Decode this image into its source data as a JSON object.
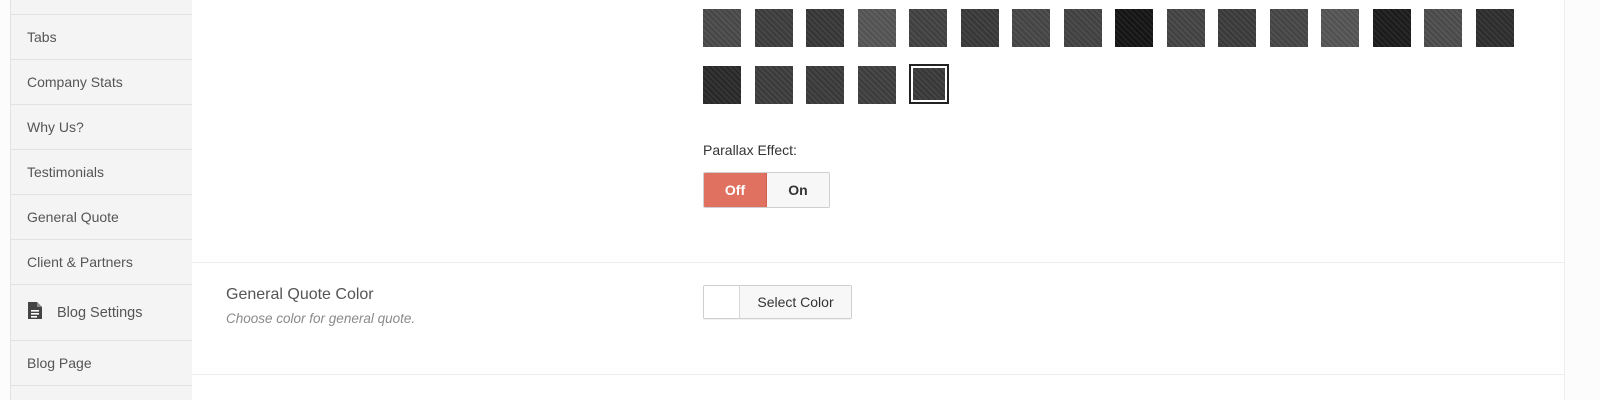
{
  "sidebar": {
    "items": [
      {
        "label": "Tabs"
      },
      {
        "label": "Company Stats"
      },
      {
        "label": "Why Us?"
      },
      {
        "label": "Testimonials"
      },
      {
        "label": "General Quote"
      },
      {
        "label": "Client & Partners"
      },
      {
        "label": "Blog Settings",
        "icon": "document-icon"
      },
      {
        "label": "Blog Page"
      }
    ]
  },
  "patterns": {
    "row1": [
      "#4a4a4a",
      "#3e3e3e",
      "#383838",
      "#565656",
      "#424242",
      "#3a3a3a",
      "#474747",
      "#434343",
      "#151515",
      "#444444",
      "#3c3c3c",
      "#474747",
      "#555555",
      "#1c1c1c",
      "#4d4d4d",
      "#2e2e2e"
    ],
    "row2": [
      "#2a2a2a",
      "#3d3d3d",
      "#3b3b3b",
      "#3f3f3f",
      "#3a3a3a"
    ],
    "selected_index": 4
  },
  "parallax": {
    "label": "Parallax Effect:",
    "off_label": "Off",
    "on_label": "On",
    "value": "Off",
    "accent": "#e07160"
  },
  "general_quote_color": {
    "title": "General Quote Color",
    "description": "Choose color for general quote.",
    "button_label": "Select Color",
    "swatch_color": "#ffffff"
  }
}
